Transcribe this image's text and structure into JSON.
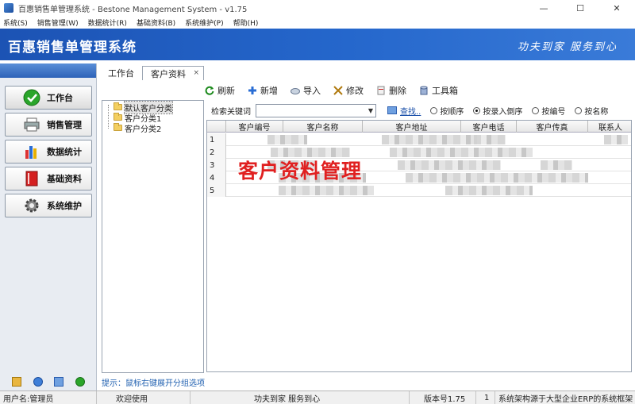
{
  "window": {
    "title": "百惠销售单管理系统 - Bestone Management System - v1.75",
    "min": "—",
    "max": "☐",
    "close": "✕"
  },
  "menu": [
    "系统(S)",
    "销售管理(W)",
    "数据统计(R)",
    "基础资料(B)",
    "系统维护(P)",
    "帮助(H)"
  ],
  "banner": {
    "title": "百惠销售单管理系统",
    "slogan": "功夫到家 服务到心"
  },
  "nav": [
    {
      "label": "工作台",
      "icon": "check-circle-icon"
    },
    {
      "label": "销售管理",
      "icon": "printer-icon"
    },
    {
      "label": "数据统计",
      "icon": "bar-chart-icon"
    },
    {
      "label": "基础资料",
      "icon": "book-icon"
    },
    {
      "label": "系统维护",
      "icon": "gear-icon"
    }
  ],
  "tabs": [
    {
      "label": "工作台"
    },
    {
      "label": "客户资料",
      "close": "×"
    }
  ],
  "toolbar": [
    {
      "label": "刷新",
      "icon": "refresh-icon"
    },
    {
      "label": "新增",
      "icon": "add-icon"
    },
    {
      "label": "导入",
      "icon": "import-icon"
    },
    {
      "label": "修改",
      "icon": "edit-icon"
    },
    {
      "label": "删除",
      "icon": "delete-icon"
    },
    {
      "label": "工具箱",
      "icon": "toolbox-icon"
    }
  ],
  "tree": [
    "默认客户分类",
    "客户分类1",
    "客户分类2"
  ],
  "hint": "提示：鼠标右键展开分组选项",
  "search": {
    "label": "检索关键词",
    "value": "",
    "find": "查找..",
    "sort": [
      {
        "label": "按顺序",
        "checked": false
      },
      {
        "label": "按录入倒序",
        "checked": true
      },
      {
        "label": "按编号",
        "checked": false
      },
      {
        "label": "按名称",
        "checked": false
      }
    ]
  },
  "table": {
    "columns": [
      "客户编号",
      "客户名称",
      "客户地址",
      "客户电话",
      "客户传真",
      "联系人"
    ],
    "rows": [
      "1",
      "2",
      "3",
      "4",
      "5"
    ]
  },
  "overlay": "客户资料管理",
  "status": {
    "user": "用户名:管理员",
    "welcome": "欢迎使用",
    "motto": "功夫到家 服务到心",
    "version": "版本号1.75",
    "count": "1",
    "note": "系统架构源于大型企业ERP的系统框架"
  }
}
